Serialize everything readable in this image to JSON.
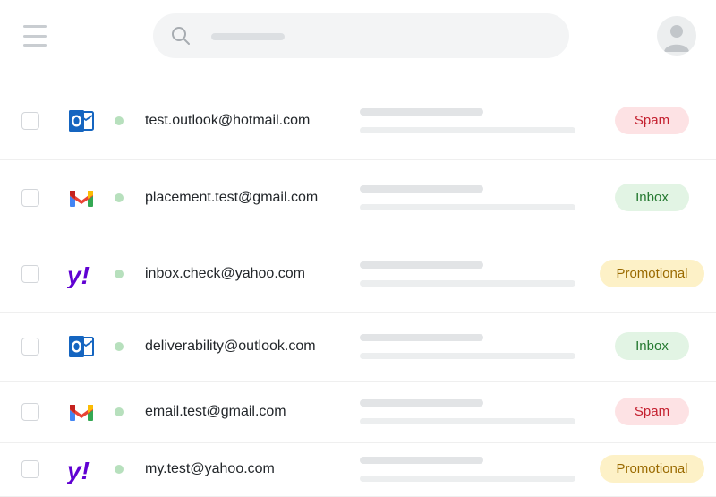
{
  "header": {
    "menu_icon": "hamburger-menu-icon",
    "search_icon": "search-icon",
    "avatar_icon": "user-avatar-icon"
  },
  "rows": [
    {
      "provider": "outlook",
      "provider_icon": "outlook-icon",
      "email": "test.outlook@hotmail.com",
      "status": "Spam",
      "status_type": "spam",
      "top": 0,
      "height": 87
    },
    {
      "provider": "gmail",
      "provider_icon": "gmail-icon",
      "email": "placement.test@gmail.com",
      "status": "Inbox",
      "status_type": "inbox"
    },
    {
      "provider": "yahoo",
      "provider_icon": "yahoo-icon",
      "email": "inbox.check@yahoo.com",
      "status": "Promotional",
      "status_type": "promo"
    },
    {
      "provider": "outlook",
      "provider_icon": "outlook-icon",
      "email": "deliverability@outlook.com",
      "status": "Inbox",
      "status_type": "inbox"
    },
    {
      "provider": "gmail",
      "provider_icon": "gmail-icon",
      "email": "email.test@gmail.com",
      "status": "Spam",
      "status_type": "spam"
    },
    {
      "provider": "yahoo",
      "provider_icon": "yahoo-icon",
      "email": "my.test@yahoo.com",
      "status": "Promotional",
      "status_type": "promo"
    }
  ],
  "colors": {
    "spam_bg": "#fde2e4",
    "spam_text": "#c4202f",
    "inbox_bg": "#e2f4e4",
    "inbox_text": "#23782f",
    "promo_bg": "#fdf1c7",
    "promo_text": "#9a6a00",
    "online_dot": "#b7e0bd"
  }
}
